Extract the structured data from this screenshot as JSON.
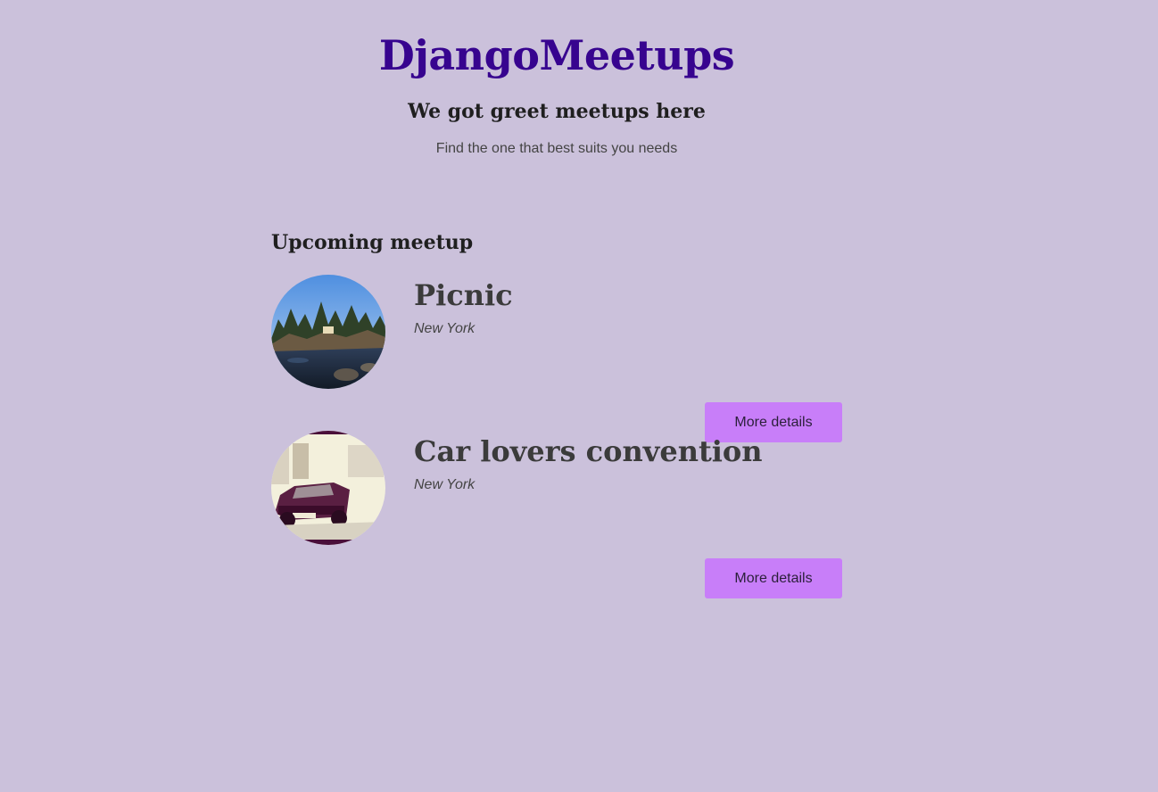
{
  "header": {
    "title": "DjangoMeetups",
    "tagline": "We got greet meetups here",
    "subtitle": "Find the one that best suits you needs"
  },
  "section": {
    "heading": "Upcoming meetup"
  },
  "meetups": [
    {
      "title": "Picnic",
      "location": "New York",
      "button_label": "More details",
      "image": "lakeside-photo"
    },
    {
      "title": "Car lovers convention",
      "location": "New York",
      "button_label": "More details",
      "image": "vintage-car-photo"
    }
  ],
  "colors": {
    "background": "#cbc1db",
    "title": "#37048f",
    "button": "#c87ef9"
  }
}
